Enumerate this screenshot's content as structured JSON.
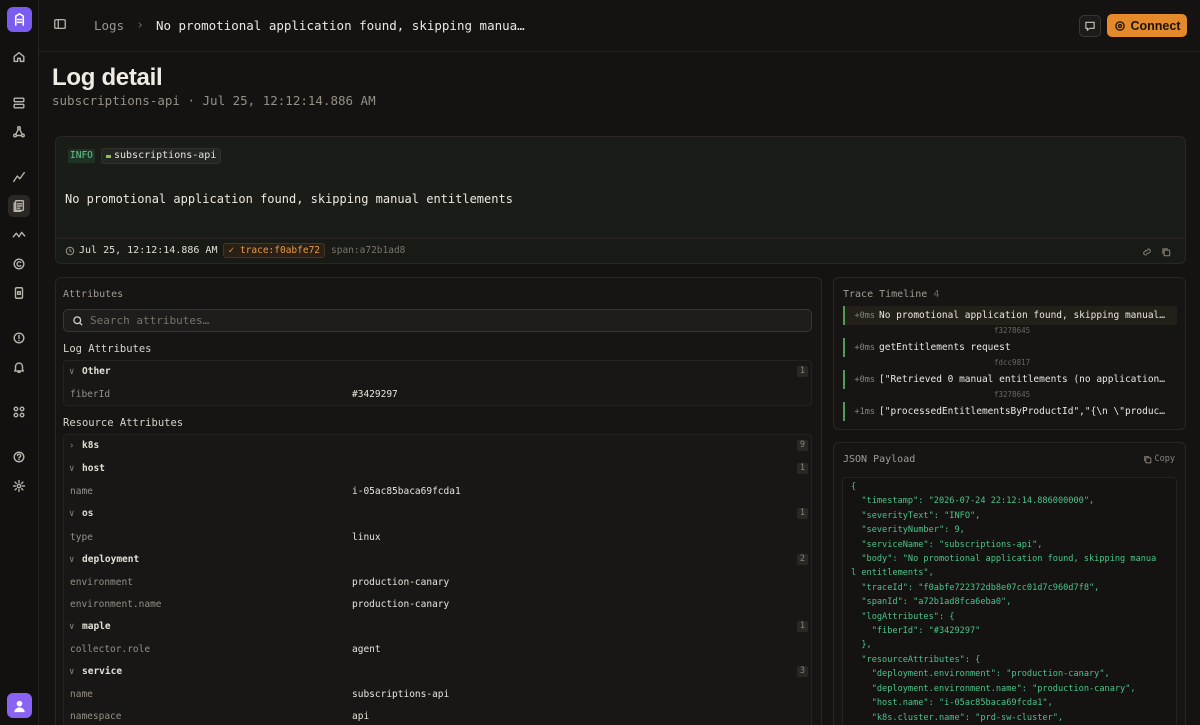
{
  "breadcrumb": {
    "root": "Logs",
    "current": "No promotional application found, skipping manua…"
  },
  "header": {
    "connect_label": "Connect"
  },
  "page": {
    "title": "Log detail",
    "subtitle": "subscriptions-api · Jul 25, 12:12:14.886 AM"
  },
  "log": {
    "severity": "INFO",
    "service": "subscriptions-api",
    "message": "No promotional application found, skipping manual entitlements",
    "timestamp": "Jul 25, 12:12:14.886 AM",
    "trace": "trace:f0abfe72",
    "span": "span:a72b1ad8"
  },
  "attributes": {
    "title": "Attributes",
    "search_placeholder": "Search attributes…",
    "log_title": "Log Attributes",
    "resource_title": "Resource Attributes",
    "other": {
      "name": "Other",
      "count": "1"
    },
    "fiberId": {
      "key": "fiberId",
      "value": "#3429297"
    },
    "k8s": {
      "name": "k8s",
      "count": "9"
    },
    "host": {
      "name": "host",
      "count": "1",
      "key": "name",
      "value": "i-05ac85baca69fcda1"
    },
    "os": {
      "name": "os",
      "count": "1",
      "key": "type",
      "value": "linux"
    },
    "deployment": {
      "name": "deployment",
      "count": "2",
      "rows": [
        {
          "key": "environment",
          "value": "production-canary"
        },
        {
          "key": "environment.name",
          "value": "production-canary"
        }
      ]
    },
    "maple": {
      "name": "maple",
      "count": "1",
      "key": "collector.role",
      "value": "agent"
    },
    "service": {
      "name": "service",
      "count": "3",
      "rows": [
        {
          "key": "name",
          "value": "subscriptions-api"
        },
        {
          "key": "namespace",
          "value": "api"
        }
      ]
    }
  },
  "trace_timeline": {
    "title": "Trace Timeline",
    "count": "4",
    "items": [
      {
        "time": "+0ms",
        "text": "No promotional application found, skipping manual…",
        "id": "f3278645"
      },
      {
        "time": "+0ms",
        "text": "getEntitlements request",
        "id": "fdcc9817"
      },
      {
        "time": "+0ms",
        "text": "[\"Retrieved 0 manual entitlements (no application…",
        "id": "f3278645"
      },
      {
        "time": "+1ms",
        "text": "[\"processedEntitlementsByProductId\",\"{\\n \\\"produc…"
      }
    ]
  },
  "json_payload": {
    "title": "JSON Payload",
    "copy_label": "Copy",
    "text": "{\n  \"timestamp\": \"2026-07-24 22:12:14.886000000\",\n  \"severityText\": \"INFO\",\n  \"severityNumber\": 9,\n  \"serviceName\": \"subscriptions-api\",\n  \"body\": \"No promotional application found, skipping manua\nl entitlements\",\n  \"traceId\": \"f0abfe722372db8e07cc01d7c960d7f8\",\n  \"spanId\": \"a72b1ad8fca6eba0\",\n  \"logAttributes\": {\n    \"fiberId\": \"#3429297\"\n  },\n  \"resourceAttributes\": {\n    \"deployment.environment\": \"production-canary\",\n    \"deployment.environment.name\": \"production-canary\",\n    \"host.name\": \"i-05ac85baca69fcda1\",\n    \"k8s.cluster.name\": \"prd-sw-cluster\","
  },
  "colors": {
    "accent": "#e48a2a",
    "brand": "#7b5cf0",
    "info_green": "#5fc98a",
    "trace_orange": "#e79a45"
  },
  "icons": [
    "app-logo-icon",
    "home-icon",
    "database-icon",
    "graph-icon",
    "chart-line-icon",
    "logs-icon",
    "activity-icon",
    "copy-icon",
    "mobile-icon",
    "alert-icon",
    "bell-icon",
    "integrations-icon",
    "help-icon",
    "settings-icon",
    "user-avatar-icon",
    "sidebar-toggle-icon",
    "feedback-icon",
    "clock-icon",
    "search-icon",
    "link-icon"
  ]
}
